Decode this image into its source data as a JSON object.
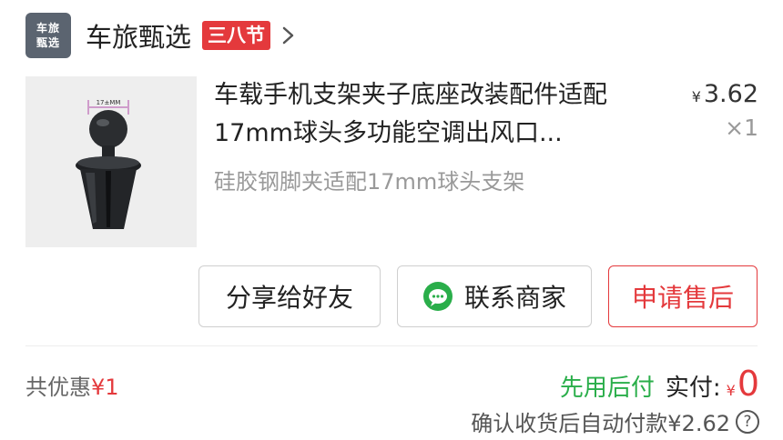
{
  "shop": {
    "logo_line1": "车旅",
    "logo_line2": "甄选",
    "name": "车旅甄选",
    "promo_badge": "三八节"
  },
  "product": {
    "title": "车载手机支架夹子底座改装配件适配17mm球头多功能空调出风口...",
    "image_label": "17±MM",
    "price_currency": "¥",
    "price": "3.62",
    "quantity": "×1",
    "variant": "硅胶钢脚夹适配17mm球头支架"
  },
  "actions": {
    "share": "分享给好友",
    "contact": "联系商家",
    "after_sale": "申请售后"
  },
  "summary": {
    "discount_label": "共优惠",
    "discount_amount": "¥1",
    "pay_later": "先用后付",
    "actual_label": "实付:",
    "actual_currency": "¥",
    "actual_value": "0",
    "auto_pay_note": "确认收货后自动付款¥2.62",
    "help_glyph": "?"
  },
  "colors": {
    "accent_red": "#e4393c",
    "pay_later_green": "#2aae4a",
    "logo_bg": "#5b6470"
  }
}
